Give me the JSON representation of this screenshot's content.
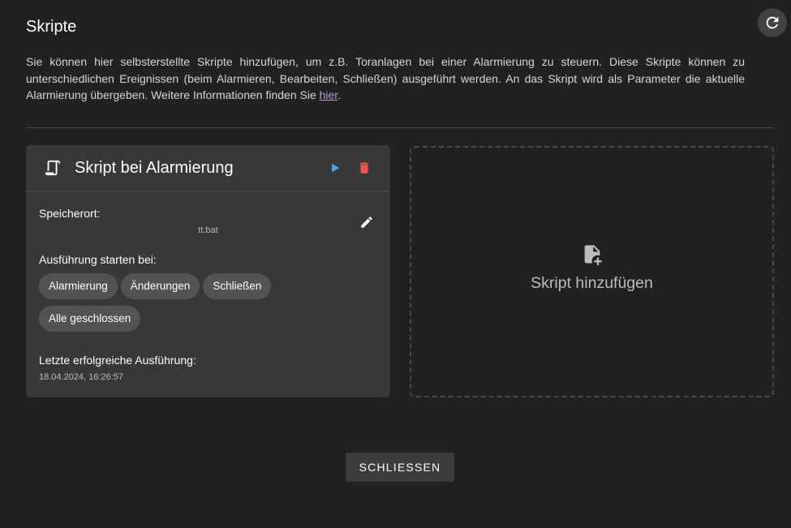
{
  "header": {
    "title": "Skripte",
    "refresh_icon": "refresh-icon"
  },
  "description": {
    "text": "Sie können hier selbsterstellte Skripte hinzufügen, um z.B. Toranlagen bei einer Alarmierung zu steuern. Diese Skripte können zu unterschiedlichen Ereignissen (beim Alarmieren, Bearbeiten, Schließen) ausgeführt werden. An das Skript wird als Parameter die aktuelle Alarmierung übergeben. Weitere Informationen finden Sie ",
    "link_text": "hier",
    "suffix": "."
  },
  "script_card": {
    "title": "Skript bei Alarmierung",
    "icons": {
      "script": "script-icon",
      "run": "play-icon",
      "delete": "delete-icon",
      "edit": "pencil-icon"
    },
    "storage_label": "Speicherort:",
    "storage_value": "tt.bat",
    "execution_label": "Ausführung starten bei:",
    "triggers": [
      "Alarmierung",
      "Änderungen",
      "Schließen",
      "Alle geschlossen"
    ],
    "last_execution_label": "Letzte erfolgreiche Ausführung:",
    "last_execution_value": "18.04.2024, 16:26:57"
  },
  "add_card": {
    "label": "Skript hinzufügen",
    "icon": "file-plus-icon"
  },
  "footer": {
    "close_label": "SCHLIESSEN"
  },
  "colors": {
    "background": "#212121",
    "card": "#383838",
    "chip": "#535353",
    "run_accent": "#42a5f5",
    "delete_accent": "#ef5350",
    "link": "#b39ddb"
  }
}
